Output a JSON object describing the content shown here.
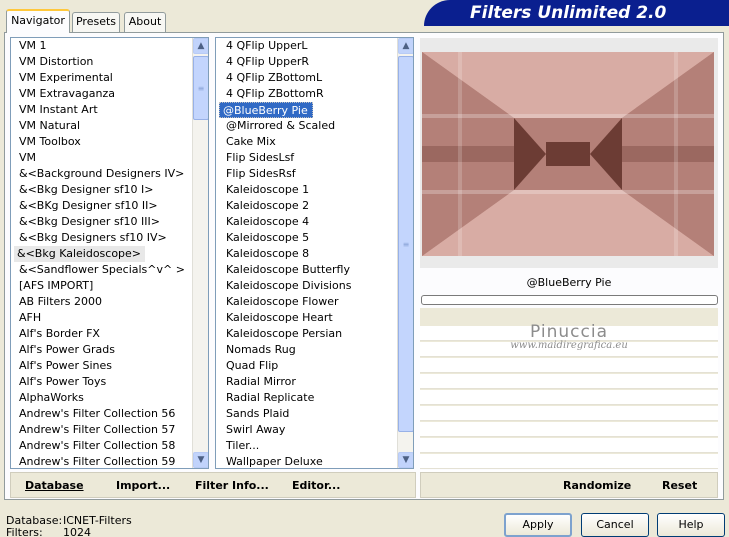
{
  "tabs": [
    {
      "label": "Navigator"
    },
    {
      "label": "Presets"
    },
    {
      "label": "About"
    }
  ],
  "title": "Filters Unlimited 2.0",
  "categories": {
    "items": [
      "VM 1",
      "VM Distortion",
      "VM Experimental",
      "VM Extravaganza",
      "VM Instant Art",
      "VM Natural",
      "VM Toolbox",
      "VM",
      "&<Background Designers IV>",
      "&<Bkg Designer sf10 I>",
      "&<BKg Designer sf10 II>",
      "&<Bkg Designer sf10 III>",
      "&<Bkg Designers sf10 IV>",
      "&<Bkg Kaleidoscope>",
      "&<Sandflower Specials^v^ >",
      "[AFS IMPORT]",
      "AB Filters 2000",
      "AFH",
      "Alf's Border FX",
      "Alf's Power Grads",
      "Alf's Power Sines",
      "Alf's Power Toys",
      "AlphaWorks",
      "Andrew's Filter Collection 56",
      "Andrew's Filter Collection 57",
      "Andrew's Filter Collection 58",
      "Andrew's Filter Collection 59"
    ],
    "selected": "&<Bkg Kaleidoscope>"
  },
  "filters": {
    "items": [
      "4 QFlip UpperL",
      "4 QFlip UpperR",
      "4 QFlip ZBottomL",
      "4 QFlip ZBottomR",
      "@BlueBerry Pie",
      "@Mirrored & Scaled",
      "Cake Mix",
      "Flip SidesLsf",
      "Flip SidesRsf",
      "Kaleidoscope 1",
      "Kaleidoscope 2",
      "Kaleidoscope 4",
      "Kaleidoscope 5",
      "Kaleidoscope 8",
      "Kaleidoscope Butterfly",
      "Kaleidoscope Divisions",
      "Kaleidoscope Flower",
      "Kaleidoscope Heart",
      "Kaleidoscope Persian",
      "Nomads Rug",
      "Quad Flip",
      "Radial Mirror",
      "Radial Replicate",
      "Sands Plaid",
      "Swirl Away",
      "Tiler...",
      "Wallpaper Deluxe"
    ],
    "selected": "@BlueBerry Pie"
  },
  "preview": {
    "filter_name": "@BlueBerry Pie",
    "progress": 0,
    "colors": {
      "light": "#d8aca4",
      "mid": "#b48078",
      "dark": "#6c3c34"
    }
  },
  "watermark": {
    "name": "Pinuccia",
    "url": "www.maidiregrafica.eu"
  },
  "links": {
    "database": "Database",
    "import": "Import...",
    "filter_info": "Filter Info...",
    "editor": "Editor...",
    "randomize": "Randomize",
    "reset": "Reset"
  },
  "footer": {
    "database_label": "Database:",
    "database_value": "ICNET-Filters",
    "filters_label": "Filters:",
    "filters_value": "1024"
  },
  "buttons": {
    "apply": "Apply",
    "cancel": "Cancel",
    "help": "Help"
  },
  "colors": {
    "banner": "#0a1f8f",
    "selection": "#316ac5",
    "tab_accent": "#ffc83c"
  }
}
